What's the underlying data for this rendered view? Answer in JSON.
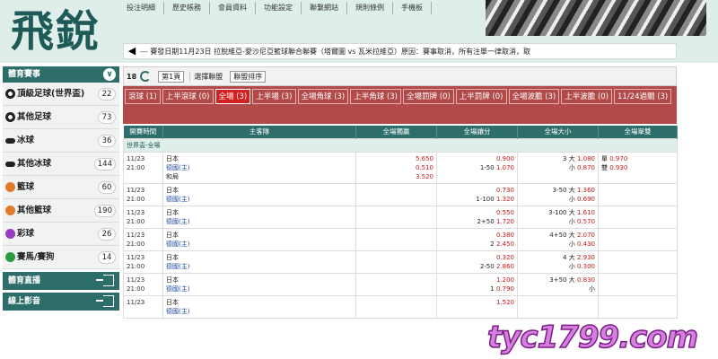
{
  "logo": "飛銳",
  "topnav": [
    "投注明細",
    "歷史帳務",
    "會員資料",
    "功能設定",
    "聯繫網站",
    "規則條例",
    "手機板"
  ],
  "marquee": "--- 賽發日期11月23日 拉脫維亞-愛沙尼亞籃球聯合聯賽（塔爾圖 vs 瓦米拉維亞）原因：賽事取消，所有注單一律取消，取",
  "sidebar": {
    "header": "體育賽事",
    "items": [
      {
        "label": "頂級足球(世界盃)",
        "count": "22",
        "icon": "soccer-icon"
      },
      {
        "label": "其他足球",
        "count": "73",
        "icon": "soccer-icon"
      },
      {
        "label": "冰球",
        "count": "36",
        "icon": "hockey-icon"
      },
      {
        "label": "其他冰球",
        "count": "144",
        "icon": "hockey-icon"
      },
      {
        "label": "籃球",
        "count": "60",
        "icon": "basketball-icon"
      },
      {
        "label": "其他籃球",
        "count": "190",
        "icon": "basketball-icon"
      },
      {
        "label": "彩球",
        "count": "26",
        "icon": "lottery-icon"
      },
      {
        "label": "賽馬/賽狗",
        "count": "14",
        "icon": "horse-icon"
      }
    ],
    "live": "體育直播",
    "video": "線上影音"
  },
  "toolbar": {
    "count": "18",
    "page": "第1頁",
    "filter": "選擇聯盟",
    "sort": "聯盟排序"
  },
  "tabs": [
    "滾球 (1)",
    "上半滾球 (0)",
    "全場 (3)",
    "上半場 (3)",
    "全場角球 (3)",
    "上半角球 (3)",
    "全場罰牌 (0)",
    "上半罰牌 (0)",
    "全場波膽 (3)",
    "上半波膽 (0)",
    "11/24過關 (3)"
  ],
  "colors": {
    "teal": "#2d6e6b",
    "red_tab": "#b34a4a",
    "active_tab": "#d32020"
  },
  "table": {
    "headers": [
      "開賽時間",
      "主客隊",
      "全場獨贏",
      "全場讓分",
      "全場大小",
      "全場單雙"
    ],
    "league": "世界盃-全場",
    "rows": [
      {
        "date": "11/23",
        "time": "21:00",
        "team1": "日本",
        "team2": "德國(主)",
        "team3": "和局",
        "ml": [
          "5.650",
          "0.510",
          "3.520"
        ],
        "hcp": [
          "",
          "1-50"
        ],
        "hodds": [
          "0.900",
          "1.070"
        ],
        "ou": [
          "3",
          "大",
          "小"
        ],
        "oodds": [
          "1.080",
          "0.870"
        ],
        "oe": [
          "單",
          "雙"
        ],
        "oeodds": [
          "0.970",
          "0.930"
        ]
      },
      {
        "date": "11/23",
        "time": "21:00",
        "team1": "日本",
        "team2": "德國(主)",
        "hcp": [
          "",
          "1-100"
        ],
        "hodds": [
          "0.730",
          "1.320"
        ],
        "ou": [
          "3-50",
          "大",
          "小"
        ],
        "oodds": [
          "1.360",
          "0.690"
        ]
      },
      {
        "date": "11/23",
        "time": "21:00",
        "team1": "日本",
        "team2": "德國(主)",
        "hcp": [
          "",
          "2+50"
        ],
        "hodds": [
          "0.550",
          "1.720"
        ],
        "ou": [
          "3-100",
          "大",
          "小"
        ],
        "oodds": [
          "1.610",
          "0.570"
        ]
      },
      {
        "date": "11/23",
        "time": "21:00",
        "team1": "日本",
        "team2": "德國(主)",
        "hcp": [
          "",
          "2"
        ],
        "hodds": [
          "0.380",
          "2.450"
        ],
        "ou": [
          "4+50",
          "大",
          "小"
        ],
        "oodds": [
          "2.070",
          "0.430"
        ]
      },
      {
        "date": "11/23",
        "time": "21:00",
        "team1": "日本",
        "team2": "德國(主)",
        "hcp": [
          "",
          "2-50"
        ],
        "hodds": [
          "0.320",
          "2.860"
        ],
        "ou": [
          "4",
          "大",
          "小"
        ],
        "oodds": [
          "2.930",
          "0.300"
        ]
      },
      {
        "date": "11/23",
        "time": "21:00",
        "team1": "日本",
        "team2": "德國(主)",
        "hcp": [
          "",
          "1"
        ],
        "hodds": [
          "1.200",
          "0.790"
        ],
        "ou": [
          "3+50",
          "大",
          "小"
        ],
        "oodds": [
          "0.830",
          ""
        ]
      },
      {
        "date": "11/23",
        "time": "",
        "team1": "日本",
        "team2": "德國(主)",
        "hcp": [
          "",
          ""
        ],
        "hodds": [
          "1.520",
          ""
        ],
        "ou": [
          "",
          "",
          ""
        ],
        "oodds": [
          "",
          ""
        ]
      }
    ]
  },
  "watermark": "tyc1799.com"
}
